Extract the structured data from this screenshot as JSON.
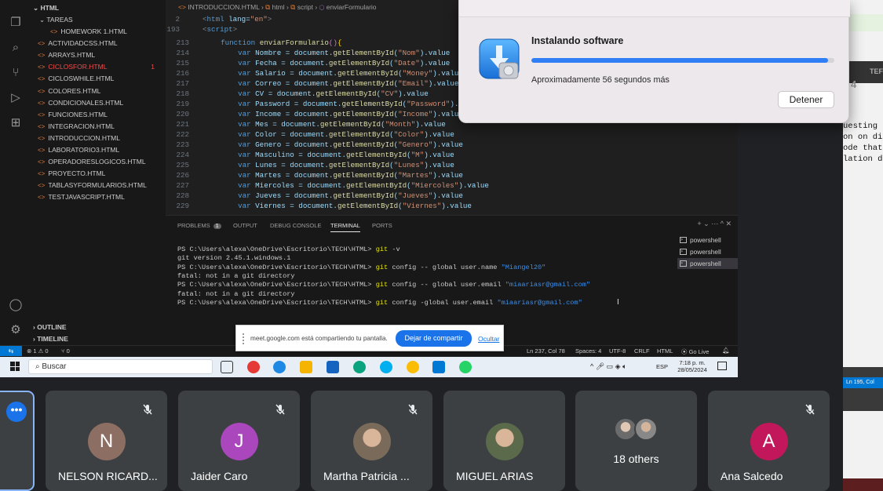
{
  "vscode": {
    "tab_title": "INTRODUCCION.HTML",
    "breadcrumb": [
      "html",
      "script",
      "enviarFormulario"
    ],
    "sidebar": {
      "folder": "HTML",
      "subfolder": "TAREAS",
      "files": [
        {
          "name": "HOMEWORK 1.HTML",
          "error": false,
          "badge": ""
        },
        {
          "name": "ACTIVIDADCSS.HTML",
          "error": false,
          "badge": ""
        },
        {
          "name": "ARRAYS.HTML",
          "error": false,
          "badge": ""
        },
        {
          "name": "CICLOSFOR.HTML",
          "error": true,
          "badge": "1"
        },
        {
          "name": "CICLOSWHILE.HTML",
          "error": false,
          "badge": ""
        },
        {
          "name": "COLORES.HTML",
          "error": false,
          "badge": ""
        },
        {
          "name": "CONDICIONALES.HTML",
          "error": false,
          "badge": ""
        },
        {
          "name": "FUNCIONES.HTML",
          "error": false,
          "badge": ""
        },
        {
          "name": "INTEGRACION.HTML",
          "error": false,
          "badge": ""
        },
        {
          "name": "INTRODUCCION.HTML",
          "error": false,
          "badge": ""
        },
        {
          "name": "LABORATORIO3.HTML",
          "error": false,
          "badge": ""
        },
        {
          "name": "OPERADORESLOGICOS.HTML",
          "error": false,
          "badge": ""
        },
        {
          "name": "PROYECTO.HTML",
          "error": false,
          "badge": ""
        },
        {
          "name": "TABLASYFORMULARIOS.HTML",
          "error": false,
          "badge": ""
        },
        {
          "name": "TESTJAVASCRIPT.HTML",
          "error": false,
          "badge": ""
        }
      ],
      "outline": "OUTLINE",
      "timeline": "TIMELINE"
    },
    "sticky_lines": [
      {
        "num": "2",
        "html": "<span class=\"tag\">&lt;</span><span class=\"kw\">html</span> <span style=\"color:#9cdcfe\">lang</span>=<span class=\"str\">\"en\"</span><span class=\"tag\">&gt;</span>"
      },
      {
        "num": "193",
        "html": "<span class=\"tag\">&lt;</span><span class=\"kw\">script</span><span class=\"tag\">&gt;</span>"
      }
    ],
    "code_lines": [
      {
        "num": "213",
        "indent": 2,
        "text": "function enviarFormulario(){"
      },
      {
        "num": "214",
        "indent": 4,
        "var": "Nombre",
        "id": "Nom"
      },
      {
        "num": "215",
        "indent": 4,
        "var": "Fecha",
        "id": "Date"
      },
      {
        "num": "216",
        "indent": 4,
        "var": "Salario",
        "id": "Money"
      },
      {
        "num": "217",
        "indent": 4,
        "var": "Correo",
        "id": "Email"
      },
      {
        "num": "218",
        "indent": 4,
        "var": "CV",
        "id": "CV"
      },
      {
        "num": "219",
        "indent": 4,
        "var": "Password",
        "id": "Password"
      },
      {
        "num": "220",
        "indent": 4,
        "var": "Income",
        "id": "Income"
      },
      {
        "num": "221",
        "indent": 4,
        "var": "Mes",
        "id": "Month"
      },
      {
        "num": "222",
        "indent": 4,
        "var": "Color",
        "id": "Color"
      },
      {
        "num": "223",
        "indent": 4,
        "var": "Genero",
        "id": "Genero"
      },
      {
        "num": "224",
        "indent": 4,
        "var": "Masculino",
        "id": "M"
      },
      {
        "num": "225",
        "indent": 4,
        "var": "Lunes",
        "id": "Lunes"
      },
      {
        "num": "226",
        "indent": 4,
        "var": "Martes",
        "id": "Martes"
      },
      {
        "num": "227",
        "indent": 4,
        "var": "Miercoles",
        "id": "Miercoles"
      },
      {
        "num": "228",
        "indent": 4,
        "var": "Jueves",
        "id": "Jueves"
      },
      {
        "num": "229",
        "indent": 4,
        "var": "Viernes",
        "id": "Viernes"
      }
    ],
    "panel_tabs": [
      "PROBLEMS",
      "OUTPUT",
      "DEBUG CONSOLE",
      "TERMINAL",
      "PORTS"
    ],
    "problems_count": "1",
    "terminal_lines": [
      {
        "prompt": "PS C:\\Users\\alexa\\OneDrive\\Escritorio\\TECH\\HTML>",
        "cmd": "git",
        "args": " -v",
        "quoted": ""
      },
      {
        "prompt": "",
        "cmd": "",
        "args": "git version 2.45.1.windows.1",
        "quoted": ""
      },
      {
        "prompt": "PS C:\\Users\\alexa\\OneDrive\\Escritorio\\TECH\\HTML>",
        "cmd": "git",
        "args": " config -- global user.name ",
        "quoted": "\"Miangel20\""
      },
      {
        "prompt": "",
        "cmd": "",
        "args": "fatal: not in a git directory",
        "quoted": ""
      },
      {
        "prompt": "PS C:\\Users\\alexa\\OneDrive\\Escritorio\\TECH\\HTML>",
        "cmd": "git",
        "args": " config -- global user.email ",
        "quoted": "\"miaariasr@gmail.com\""
      },
      {
        "prompt": "",
        "cmd": "",
        "args": "fatal: not in a git directory",
        "quoted": ""
      },
      {
        "prompt": "PS C:\\Users\\alexa\\OneDrive\\Escritorio\\TECH\\HTML>",
        "cmd": "git",
        "args": " config -global user.email ",
        "quoted": "\"miaariasr@gmail.com\""
      }
    ],
    "shells": [
      "powershell",
      "powershell",
      "powershell"
    ],
    "statusbar": {
      "problems": "⊗ 1 ⚠ 0",
      "ports": "⑂ 0",
      "position": "Ln 237, Col 78",
      "spaces": "Spaces: 4",
      "encoding": "UTF-8",
      "eol": "CRLF",
      "language": "HTML",
      "golive": "Go Live"
    }
  },
  "share_banner": {
    "text": "meet.google.com está compartiendo tu pantalla.",
    "stop_button": "Dejar de compartir",
    "hide_link": "Ocultar"
  },
  "taskbar": {
    "search_placeholder": "Buscar",
    "lang": "ESP",
    "time": "7:18 p. m.",
    "date": "28/05/2024"
  },
  "install_dialog": {
    "title": "Instalando software",
    "subtitle": "Aproximadamente 56 segundos más",
    "button": "Detener",
    "progress": 0.98
  },
  "right_app": {
    "text_lines": [
      "uesting",
      "on on di",
      "ode that",
      "lation d"
    ],
    "label_top": "TEF",
    "label_mid": "4",
    "status": "Ln 195, Col"
  },
  "participants": [
    {
      "name": "NELSON RICARD...",
      "initial": "N",
      "color": "#8d6e63",
      "muted": true,
      "type": "initial"
    },
    {
      "name": "Jaider Caro",
      "initial": "J",
      "color": "#ab47bc",
      "muted": true,
      "type": "initial"
    },
    {
      "name": "Martha Patricia ...",
      "initial": "",
      "color": "#7a6a5a",
      "muted": true,
      "type": "photo"
    },
    {
      "name": "MIGUEL ARIAS",
      "initial": "",
      "color": "#5a6a4a",
      "muted": false,
      "type": "photo"
    },
    {
      "name": "18 others",
      "initial": "",
      "color": "#777777",
      "muted": false,
      "type": "group"
    },
    {
      "name": "Ana Salcedo",
      "initial": "A",
      "color": "#c2185b",
      "muted": true,
      "type": "initial"
    }
  ]
}
